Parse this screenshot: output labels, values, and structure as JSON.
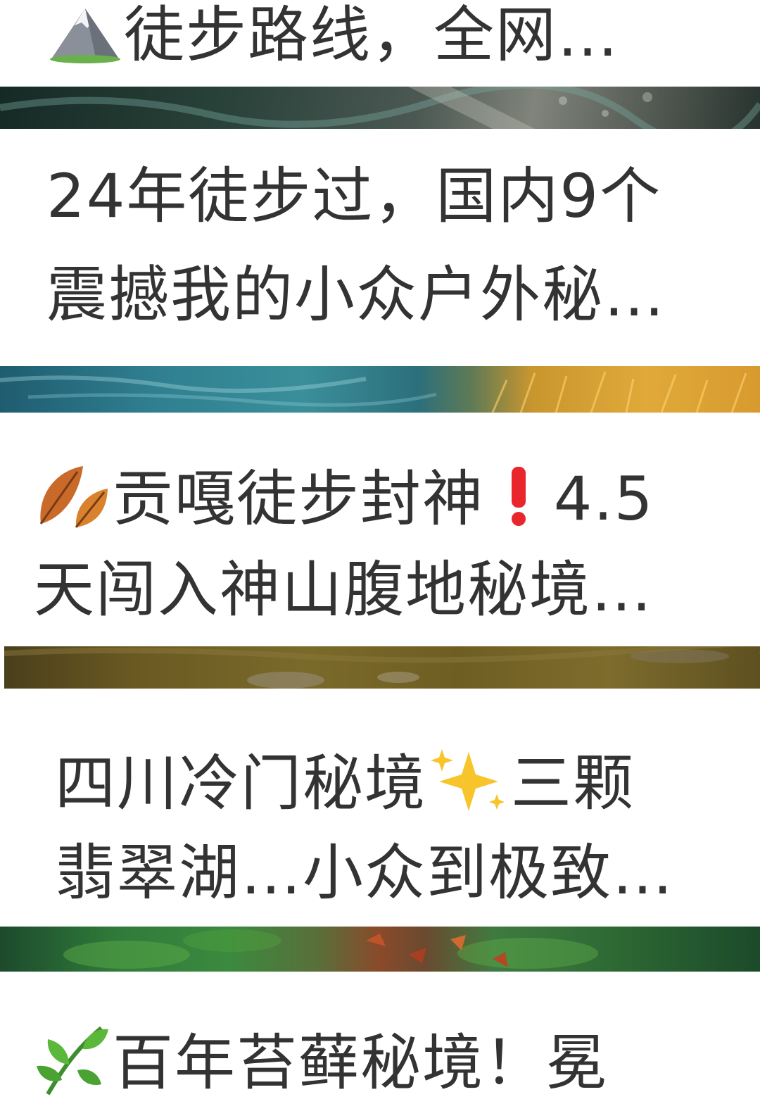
{
  "posts": [
    {
      "title_lines": [
        "徒步路线，全网…"
      ],
      "leading_icon": "mountain-icon"
    },
    {
      "title_lines": [
        "24年徒步过，国内9个",
        "震撼我的小众户外秘…"
      ]
    },
    {
      "title_lines": [
        "贡嘎徒步封神",
        "4.5",
        "天闯入神山腹地秘境…"
      ],
      "leading_icon": "fallen-leaf-icon",
      "inline_icon": "exclamation-icon"
    },
    {
      "title_lines": [
        "四川冷门秘境",
        "三颗",
        "翡翠湖…小众到极致…"
      ],
      "inline_icon": "sparkles-icon"
    },
    {
      "title_lines": [
        "百年苔藓秘境！冕"
      ],
      "leading_icon": "herb-icon"
    }
  ],
  "colors": {
    "text": "#333333",
    "background": "#ffffff",
    "exclamation": "#e8262c",
    "sparkle": "#f7c52b"
  }
}
